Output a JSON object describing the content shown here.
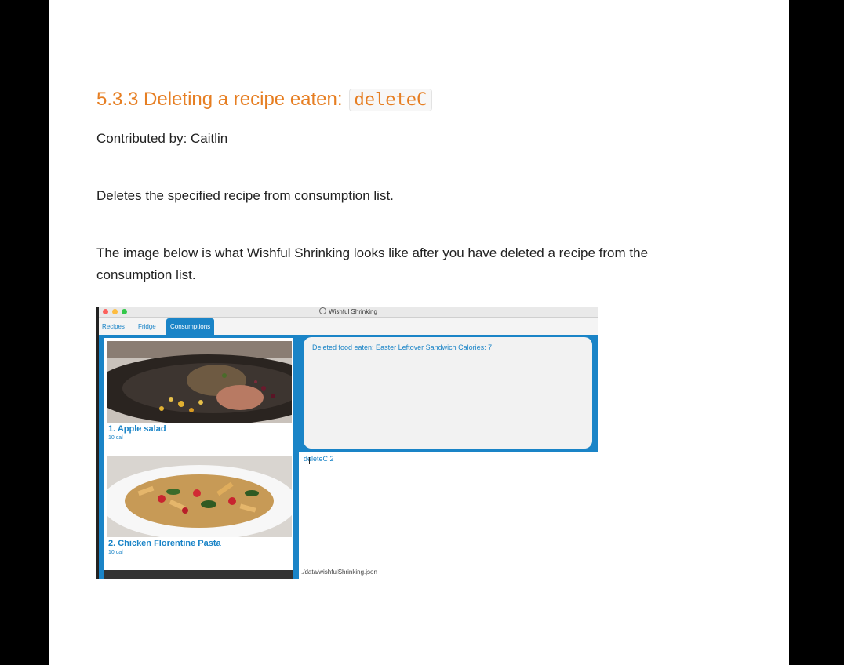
{
  "doc": {
    "heading": "5.3.3 Deleting a recipe eaten:",
    "heading_code": "deleteC",
    "contributed": "Contributed by: Caitlin",
    "description": "Deletes the specified recipe from consumption list.",
    "image_intro": "The image below is what Wishful Shrinking looks like after you have deleted a recipe from the consumption list."
  },
  "app": {
    "window_title": "Wishful Shrinking",
    "tabs": [
      {
        "label": "Recipes",
        "active": false
      },
      {
        "label": "Fridge",
        "active": false
      },
      {
        "label": "Consumptions",
        "active": true
      }
    ],
    "consumptions": [
      {
        "title": "1.  Apple salad",
        "calories": "10 cal"
      },
      {
        "title": "2.  Chicken Florentine Pasta",
        "calories": "10 cal"
      }
    ],
    "result_message": "Deleted food eaten: Easter Leftover Sandwich Calories: 7",
    "command_input": "deleteC 2",
    "status_path": "./data/wishfulShrinking.json"
  },
  "colors": {
    "accent": "#1a84c7",
    "heading": "#e67e22",
    "traffic_close": "#fc605c",
    "traffic_min": "#fdbc40",
    "traffic_max": "#34c84a"
  },
  "icons": [
    "close-dot-icon",
    "minimize-dot-icon",
    "maximize-dot-icon",
    "app-icon"
  ]
}
